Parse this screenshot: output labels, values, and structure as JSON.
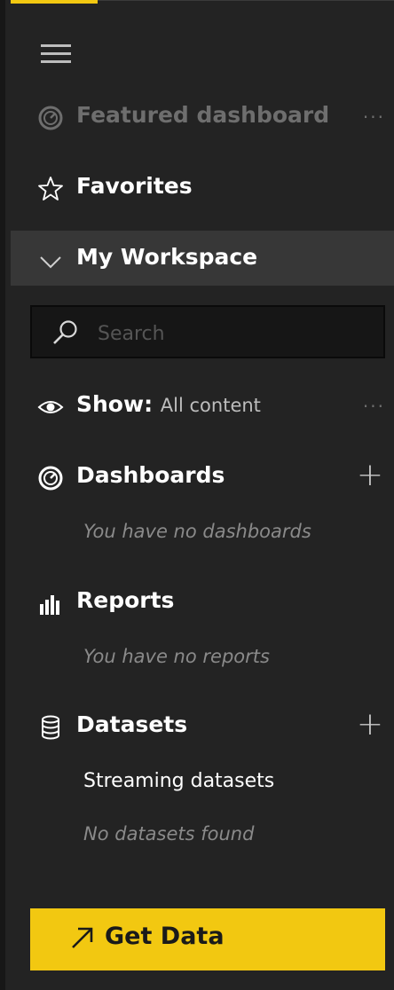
{
  "nav": {
    "menu_icon": "hamburger-icon",
    "featured": {
      "label": "Featured dashboard",
      "icon": "gauge-icon",
      "more": "···"
    },
    "favorites": {
      "label": "Favorites",
      "icon": "star-icon"
    },
    "workspace": {
      "label": "My Workspace",
      "icon": "chevron-down-icon"
    }
  },
  "search": {
    "placeholder": "Search",
    "value": "",
    "icon": "search-icon"
  },
  "show": {
    "label": "Show:",
    "value": "All content",
    "icon": "eye-icon",
    "more": "···"
  },
  "sections": {
    "dashboards": {
      "label": "Dashboards",
      "icon": "gauge-icon",
      "add": "+",
      "empty": "You have no dashboards"
    },
    "reports": {
      "label": "Reports",
      "icon": "bar-chart-icon",
      "empty": "You have no reports"
    },
    "datasets": {
      "label": "Datasets",
      "icon": "database-icon",
      "add": "+",
      "streaming": "Streaming datasets",
      "empty": "No datasets found"
    }
  },
  "get_data": {
    "label": "Get Data",
    "icon": "arrow-up-right-icon"
  },
  "colors": {
    "accent": "#f2c811",
    "background": "#232323",
    "selected_row": "#373737",
    "dim_text": "#6e6e6e"
  }
}
